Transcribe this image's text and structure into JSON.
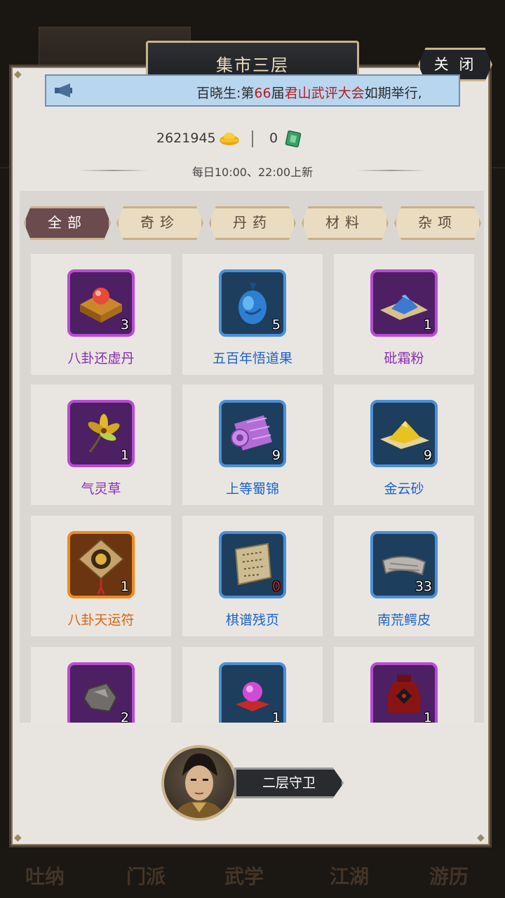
{
  "header": {
    "title": "集市三层",
    "close_label": "关 闭"
  },
  "notice": {
    "prefix": "百晓生:第",
    "number": "66",
    "middle": "届",
    "highlight": "君山武评大会",
    "suffix": "如期举行,"
  },
  "currency": {
    "gold_amount": "2621945",
    "jade_amount": "0"
  },
  "refresh_text": "每日10:00、22:00上新",
  "tabs": [
    {
      "label": "全部",
      "active": true
    },
    {
      "label": "奇珍",
      "active": false
    },
    {
      "label": "丹药",
      "active": false
    },
    {
      "label": "材料",
      "active": false
    },
    {
      "label": "杂项",
      "active": false
    }
  ],
  "items": [
    {
      "name": "八卦还虚丹",
      "qty": "3",
      "rarity": "purple",
      "icon": "pill-box-icon"
    },
    {
      "name": "五百年悟道果",
      "qty": "5",
      "rarity": "blue",
      "icon": "fruit-icon"
    },
    {
      "name": "砒霜粉",
      "qty": "1",
      "rarity": "purple",
      "icon": "powder-icon"
    },
    {
      "name": "气灵草",
      "qty": "1",
      "rarity": "purple",
      "icon": "herb-icon"
    },
    {
      "name": "上等蜀锦",
      "qty": "9",
      "rarity": "blue",
      "icon": "silk-roll-icon"
    },
    {
      "name": "金云砂",
      "qty": "9",
      "rarity": "blue",
      "icon": "sand-icon"
    },
    {
      "name": "八卦天运符",
      "qty": "1",
      "rarity": "orange",
      "icon": "talisman-icon"
    },
    {
      "name": "棋谱残页",
      "qty": "0",
      "rarity": "blue",
      "icon": "scroll-page-icon",
      "qty_red": true
    },
    {
      "name": "南荒鳄皮",
      "qty": "33",
      "rarity": "blue",
      "icon": "hide-icon"
    },
    {
      "name": "",
      "qty": "2",
      "rarity": "purple",
      "icon": "ore-icon"
    },
    {
      "name": "",
      "qty": "1",
      "rarity": "blue",
      "icon": "orb-icon"
    },
    {
      "name": "",
      "qty": "1",
      "rarity": "purple",
      "icon": "wine-jar-icon"
    }
  ],
  "guard": {
    "label": "二层守卫"
  },
  "bottom_nav": [
    "吐纳",
    "门派",
    "武学",
    "江湖",
    "游历"
  ],
  "colors": {
    "purple_name": "#8a2fb0",
    "blue_name": "#1d64c7",
    "orange_name": "#d9650f",
    "purple_bg": "#4d1f63",
    "blue_bg": "#1e3e5e",
    "orange_bg": "#6a3510"
  }
}
